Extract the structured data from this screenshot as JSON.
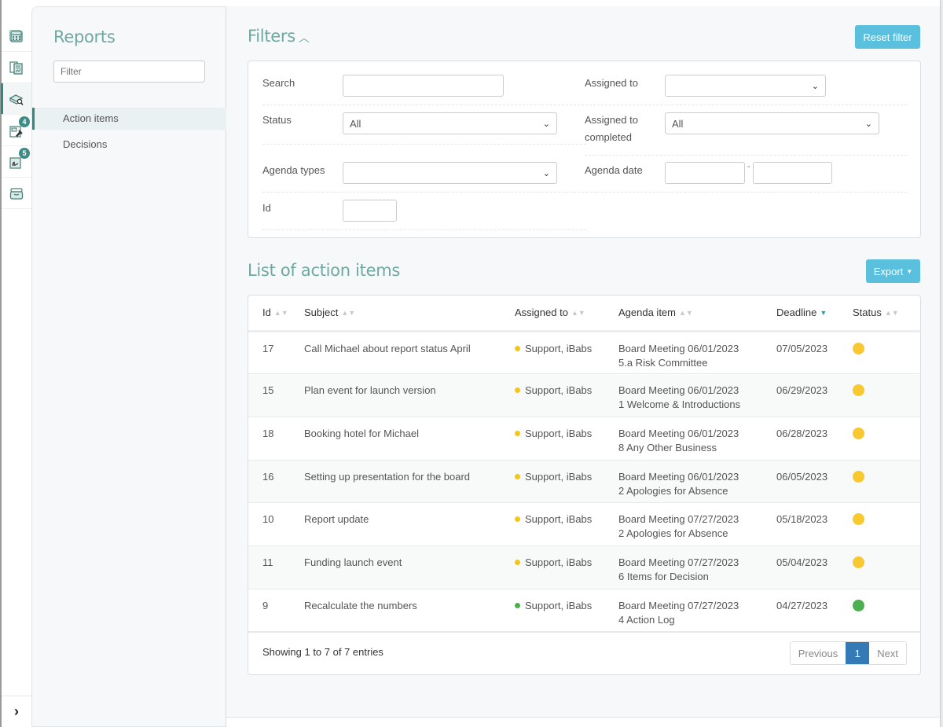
{
  "rail": {
    "items": [
      {
        "icon": "calendar-icon",
        "badge": null,
        "active": false
      },
      {
        "icon": "documents-icon",
        "badge": null,
        "active": false
      },
      {
        "icon": "reports-icon",
        "badge": null,
        "active": true
      },
      {
        "icon": "action-items-icon",
        "badge": "4",
        "active": false
      },
      {
        "icon": "signing-icon",
        "badge": "5",
        "active": false
      },
      {
        "icon": "archive-icon",
        "badge": null,
        "active": false
      }
    ],
    "expand_glyph": "›"
  },
  "reports_panel": {
    "title": "Reports",
    "filter_placeholder": "Filter",
    "nav": [
      {
        "label": "Action items",
        "active": true
      },
      {
        "label": "Decisions",
        "active": false
      }
    ]
  },
  "filters": {
    "title": "Filters",
    "collapse_glyph": "^",
    "reset_label": "Reset filter",
    "search_label": "Search",
    "search_value": "",
    "status_label": "Status",
    "status_value": "All",
    "agenda_types_label": "Agenda types",
    "agenda_types_value": "",
    "id_label": "Id",
    "id_value": "",
    "assigned_to_label": "Assigned to",
    "assigned_to_value": "",
    "assigned_completed_label_1": "Assigned to",
    "assigned_completed_label_2": "completed",
    "assigned_completed_value": "All",
    "agenda_date_label": "Agenda date",
    "agenda_date_from": "",
    "agenda_date_to": "",
    "date_separator": "-"
  },
  "list": {
    "title": "List of action items",
    "export_label": "Export",
    "columns": [
      "Id",
      "Subject",
      "Assigned to",
      "Agenda item",
      "Deadline",
      "Status"
    ],
    "sorted_column": "Deadline",
    "sort_direction": "descending",
    "rows": [
      {
        "id": "17",
        "subject": "Call Michael about report status April",
        "assigned": "Support, iBabs",
        "assigned_color": "#f5c518",
        "agenda_line1": "Board Meeting 06/01/2023",
        "agenda_line2": "5.a Risk Committee",
        "deadline": "07/05/2023",
        "status_color": "#f7c82f"
      },
      {
        "id": "15",
        "subject": "Plan event for launch version",
        "assigned": "Support, iBabs",
        "assigned_color": "#f5c518",
        "agenda_line1": "Board Meeting 06/01/2023",
        "agenda_line2": "1 Welcome & Introductions",
        "deadline": "06/29/2023",
        "status_color": "#f7c82f"
      },
      {
        "id": "18",
        "subject": "Booking hotel for Michael",
        "assigned": "Support, iBabs",
        "assigned_color": "#f5c518",
        "agenda_line1": "Board Meeting 06/01/2023",
        "agenda_line2": "8 Any Other Business",
        "deadline": "06/28/2023",
        "status_color": "#f7c82f"
      },
      {
        "id": "16",
        "subject": "Setting up presentation for the board",
        "assigned": "Support, iBabs",
        "assigned_color": "#f5c518",
        "agenda_line1": "Board Meeting 06/01/2023",
        "agenda_line2": "2 Apologies for Absence",
        "deadline": "06/05/2023",
        "status_color": "#f7c82f"
      },
      {
        "id": "10",
        "subject": "Report update",
        "assigned": "Support, iBabs",
        "assigned_color": "#f5c518",
        "agenda_line1": "Board Meeting 07/27/2023",
        "agenda_line2": "2 Apologies for Absence",
        "deadline": "05/18/2023",
        "status_color": "#f7c82f"
      },
      {
        "id": "11",
        "subject": "Funding launch event",
        "assigned": "Support, iBabs",
        "assigned_color": "#f5c518",
        "agenda_line1": "Board Meeting 07/27/2023",
        "agenda_line2": "6 Items for Decision",
        "deadline": "05/04/2023",
        "status_color": "#f7c82f"
      },
      {
        "id": "9",
        "subject": "Recalculate the numbers",
        "assigned": "Support, iBabs",
        "assigned_color": "#4caf50",
        "agenda_line1": "Board Meeting 07/27/2023",
        "agenda_line2": "4 Action Log",
        "deadline": "04/27/2023",
        "status_color": "#4caf50"
      }
    ],
    "showing": "Showing 1 to 7 of 7 entries",
    "pager": {
      "previous": "Previous",
      "current": "1",
      "next": "Next"
    }
  },
  "colors": {
    "accent": "#6ea9a2",
    "rail_active": "#2f8a7e",
    "info_button": "#5bc0de",
    "pager_active": "#337ab7"
  }
}
